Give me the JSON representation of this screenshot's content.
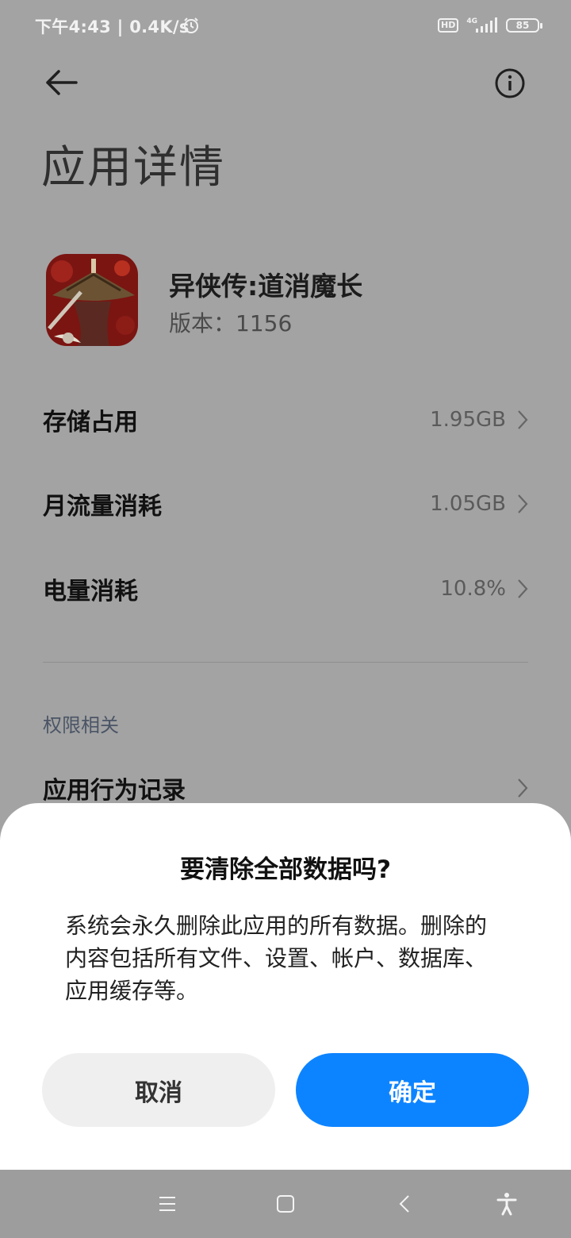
{
  "status_bar": {
    "time_text": "下午4:43 | 0.4K/s",
    "hd_label": "HD",
    "network_label": "4G",
    "battery_level": "85"
  },
  "header": {
    "title": "应用详情"
  },
  "app": {
    "name": "异侠传:道消魔长",
    "version": "版本：1156"
  },
  "details": [
    {
      "label": "存储占用",
      "value": "1.95GB"
    },
    {
      "label": "月流量消耗",
      "value": "1.05GB"
    },
    {
      "label": "电量消耗",
      "value": "10.8%"
    }
  ],
  "permissions": {
    "section_label": "权限相关",
    "items": [
      {
        "label": "应用行为记录"
      }
    ]
  },
  "dialog": {
    "title": "要清除全部数据吗?",
    "message": "系统会永久删除此应用的所有数据。删除的内容包括所有文件、设置、帐户、数据库、应用缓存等。",
    "cancel_label": "取消",
    "confirm_label": "确定",
    "confirm_color": "#0d84ff"
  },
  "icons": {
    "back": "back-arrow-icon",
    "info": "info-icon",
    "chevron": "chevron-right-icon",
    "alarm": "alarm-clock-icon",
    "signal": "signal-icon",
    "nav_menu": "menu-icon",
    "nav_home": "home-icon",
    "nav_back": "back-icon",
    "nav_accessibility": "accessibility-icon"
  }
}
